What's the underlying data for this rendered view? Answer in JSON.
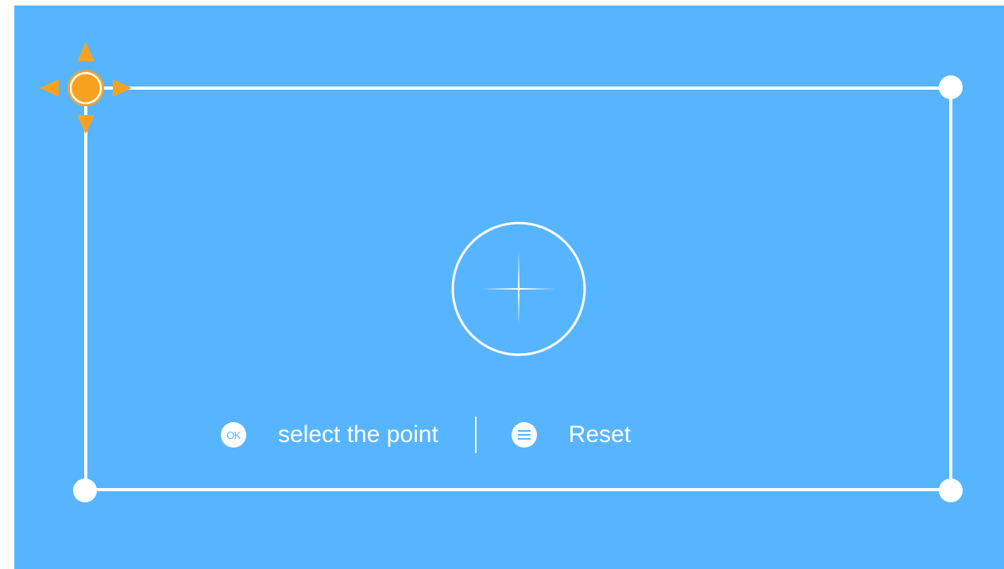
{
  "colors": {
    "background": "#57b5ff",
    "frame": "#ffffff",
    "active_corner": "#f6a220"
  },
  "icons": {
    "active_corner": "move-arrows-icon",
    "crosshair": "crosshair-icon",
    "ok": "ok-button-icon",
    "menu": "menu-icon"
  },
  "hints": {
    "ok_badge": "OK",
    "select_label": "select the point",
    "reset_label": "Reset"
  }
}
